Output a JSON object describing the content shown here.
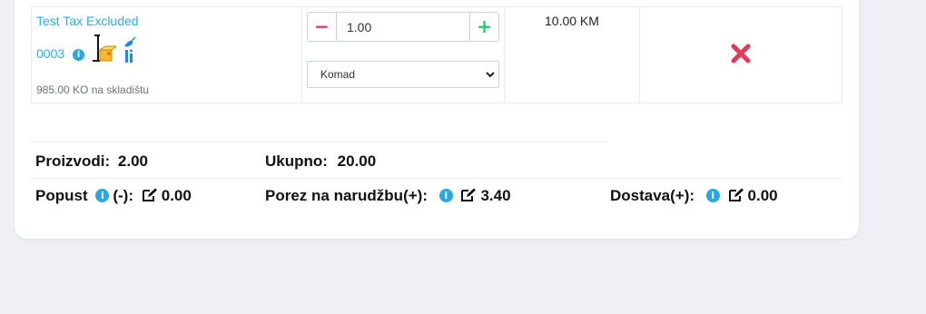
{
  "colors": {
    "link": "#27b0e4",
    "remove": "#e63757",
    "increment": "#28c76f",
    "info": "#2aa7e0"
  },
  "product": {
    "name": "Test Tax Excluded",
    "code": "0003",
    "stock": "985.00 KO na skladištu",
    "icons": [
      "info-icon",
      "package-icon",
      "tax-icon"
    ]
  },
  "quantity": {
    "value": "1.00",
    "minus": "−",
    "plus": "+"
  },
  "unit": {
    "selected": "Komad"
  },
  "price": "10.00 KM",
  "summary": {
    "products_label": "Proizvodi:",
    "products_value": "2.00",
    "total_label": "Ukupno:",
    "total_value": "20.00",
    "discount_label": "Popust",
    "discount_suffix": "(-):",
    "discount_value": "0.00",
    "tax_label": "Porez na narudžbu(+):",
    "tax_value": "3.40",
    "delivery_label": "Dostava(+):",
    "delivery_value": "0.00"
  }
}
